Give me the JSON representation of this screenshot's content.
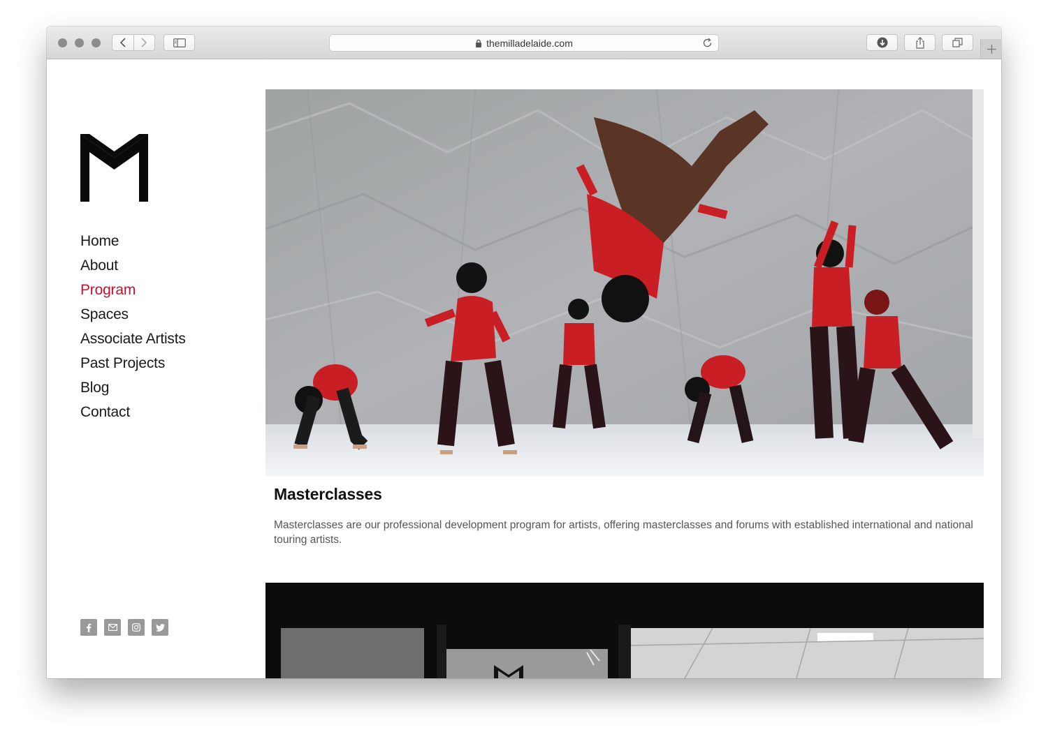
{
  "browser": {
    "url": "themilladelaide.com"
  },
  "nav": {
    "items": [
      {
        "label": "Home"
      },
      {
        "label": "About"
      },
      {
        "label": "Program",
        "active": true
      },
      {
        "label": "Spaces"
      },
      {
        "label": "Associate Artists"
      },
      {
        "label": "Past Projects"
      },
      {
        "label": "Blog"
      },
      {
        "label": "Contact"
      }
    ]
  },
  "social": {
    "icons": [
      "facebook-icon",
      "email-icon",
      "instagram-icon",
      "twitter-icon"
    ]
  },
  "content": {
    "title": "Masterclasses",
    "description": "Masterclasses are our professional development program for artists, offering masterclasses and forums with established international and national touring artists."
  },
  "colors": {
    "active_nav": "#c8102e",
    "text": "#1a1a1a",
    "social_bg": "#999999"
  }
}
